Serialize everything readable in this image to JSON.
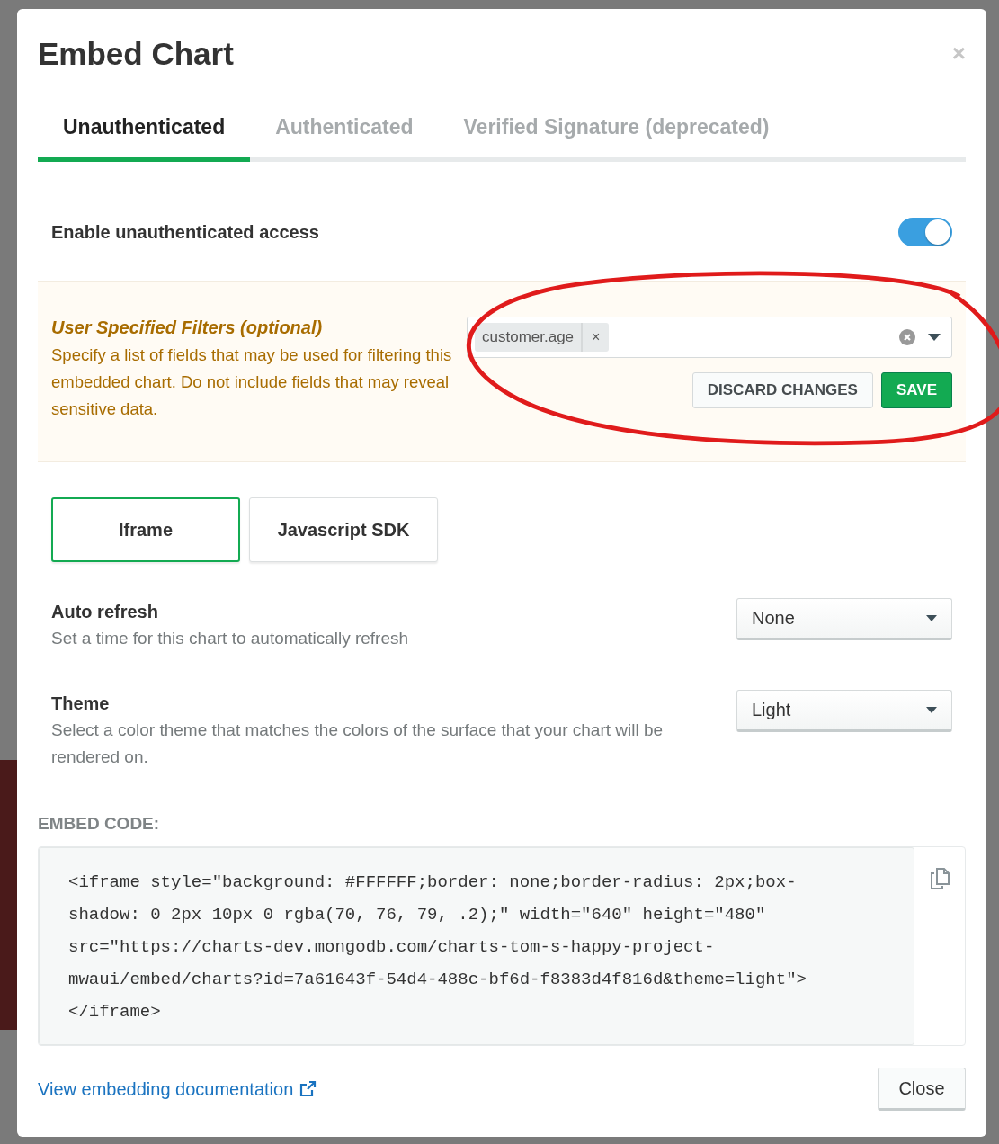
{
  "modal": {
    "title": "Embed Chart",
    "close_icon": "×"
  },
  "tabs": [
    {
      "label": "Unauthenticated",
      "selected": true
    },
    {
      "label": "Authenticated",
      "selected": false
    },
    {
      "label": "Verified Signature (deprecated)",
      "selected": false
    }
  ],
  "access": {
    "label": "Enable unauthenticated access",
    "on": true
  },
  "filters": {
    "title": "User Specified Filters (optional)",
    "description": "Specify a list of fields that may be used for filtering this embedded chart. Do not include fields that may reveal sensitive data.",
    "tags": [
      {
        "label": "customer.age",
        "remove": "×"
      }
    ],
    "buttons": [
      {
        "label": "DISCARD CHANGES",
        "kind": "secondary"
      },
      {
        "label": "SAVE",
        "kind": "primary"
      }
    ]
  },
  "embed_types": [
    {
      "label": "Iframe",
      "selected": true
    },
    {
      "label": "Javascript SDK",
      "selected": false
    }
  ],
  "settings": [
    {
      "title": "Auto refresh",
      "description": "Set a time for this chart to automatically refresh",
      "value": "None"
    },
    {
      "title": "Theme",
      "description": "Select a color theme that matches the colors of the surface that your chart will be rendered on.",
      "value": "Light"
    }
  ],
  "embed_code": {
    "label": "EMBED CODE:",
    "lines": [
      "<iframe style=\"background: #FFFFFF;border: none;border-radius: 2px;box-",
      "shadow: 0 2px 10px 0 rgba(70, 76, 79, .2);\" width=\"640\" height=\"480\"",
      "src=\"https://charts-dev.mongodb.com/charts-tom-s-happy-project-",
      "mwaui/embed/charts?id=7a61643f-54d4-488c-bf6d-f8383d4f816d&theme=light\">",
      "</iframe>"
    ]
  },
  "footer": {
    "link": "View embedding documentation",
    "button": "Close"
  }
}
